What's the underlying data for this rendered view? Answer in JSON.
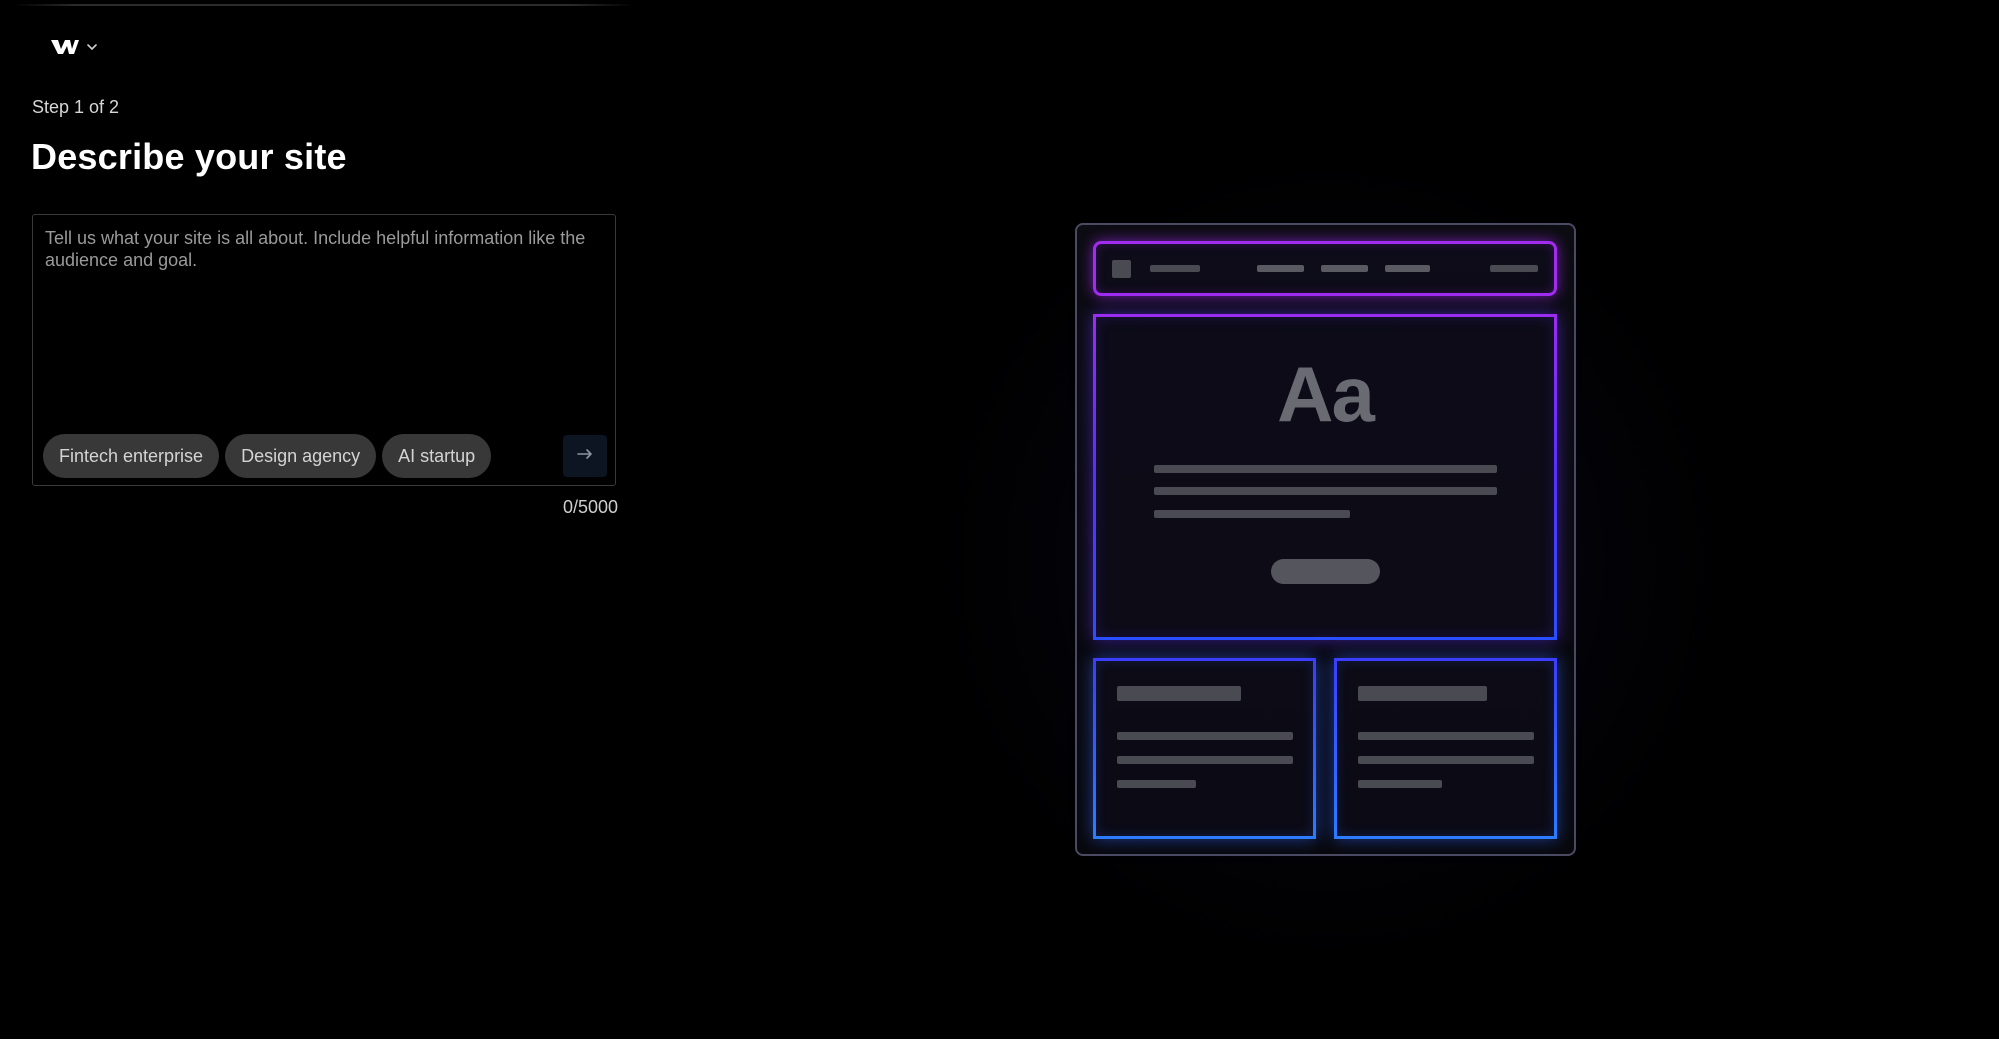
{
  "app": {
    "logo_name": "webflow-logo"
  },
  "onboarding": {
    "step_label": "Step 1 of 2",
    "title": "Describe your site",
    "prompt": {
      "placeholder": "Tell us what your site is all about. Include helpful information like the audience and goal.",
      "value": "",
      "char_count": "0/5000"
    },
    "suggestions": [
      {
        "label": "Fintech enterprise"
      },
      {
        "label": "Design agency"
      },
      {
        "label": "AI startup"
      }
    ],
    "submit_icon": "arrow-right-icon"
  },
  "illustration": {
    "hero_text": "Aa",
    "colors": {
      "nav_border": "#a12cf0",
      "hero_border_top": "#9a2cf0",
      "hero_border_bottom": "#2a4fff",
      "card_border": "#2b7cff"
    }
  }
}
